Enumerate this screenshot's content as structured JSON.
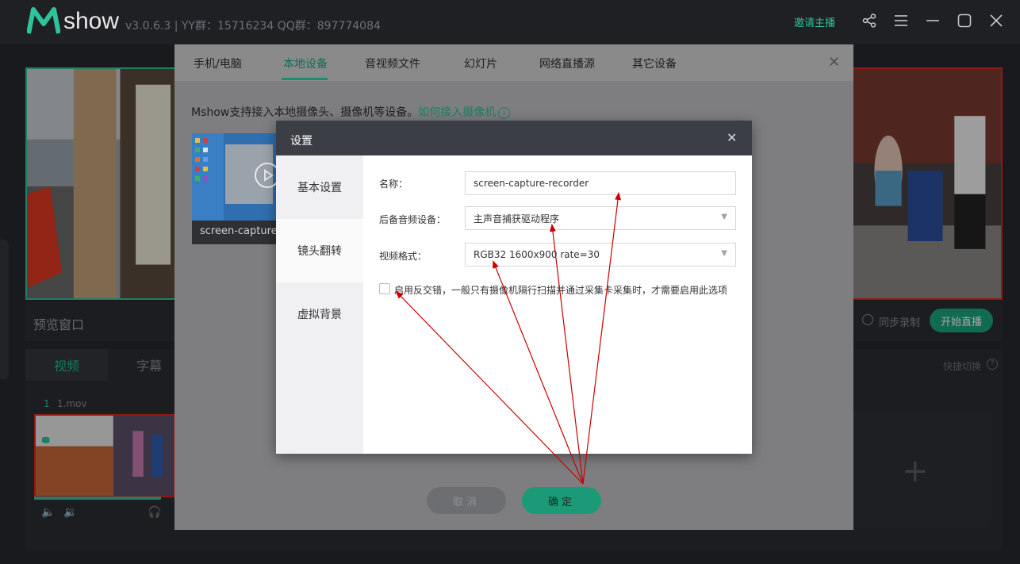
{
  "app": {
    "logo_text": "show",
    "version_info": "v3.0.6.3 | YY群：15716234 QQ群：897774084",
    "invite_label": "邀请主播",
    "icons": [
      "share-icon",
      "menu-icon",
      "minimize-icon",
      "maximize-icon",
      "close-icon"
    ]
  },
  "workspace": {
    "preview_label": "预览窗口",
    "sync_record_label": "同步录制",
    "go_live_label": "开始直播",
    "tabs": [
      "视频",
      "字幕"
    ],
    "shortcut_label": "快捷切换",
    "clip_index": "1",
    "clip_name": "1.mov"
  },
  "source_dialog": {
    "tabs": [
      "手机/电脑",
      "本地设备",
      "音视频文件",
      "幻灯片",
      "网络直播源",
      "其它设备"
    ],
    "active_tab": "本地设备",
    "intro_text": "Mshow支持接入本地摄像头、摄像机等设备。",
    "intro_link": "如何接入摄像机",
    "device_card_label": "screen-capture-recorder",
    "cancel_label": "取消",
    "confirm_label": "确定"
  },
  "settings_dialog": {
    "title": "设置",
    "nav": [
      "基本设置",
      "镜头翻转",
      "虚拟背景"
    ],
    "name_label": "名称：",
    "name_value": "screen-capture-recorder",
    "audio_label": "后备音频设备：",
    "audio_value": "主声音捕获驱动程序",
    "format_label": "视频格式：",
    "format_value": "RGB32 1600x900 rate=30",
    "deinterlace_checked": false,
    "deinterlace_label": "启用反交错，一般只有摄像机隔行扫描并通过采集卡采集时，才需要启用此选项"
  },
  "colors": {
    "accent": "#2ec39c",
    "live_red": "#e02525",
    "annotation_arrow": "#cc0000"
  }
}
